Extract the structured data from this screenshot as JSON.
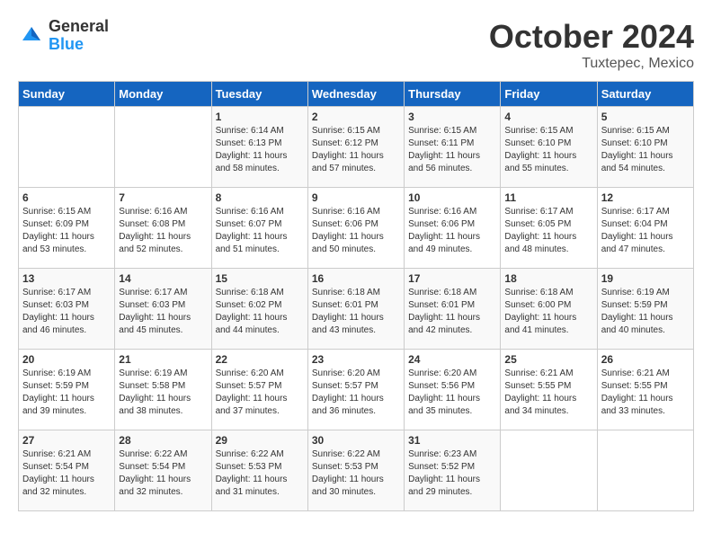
{
  "logo": {
    "general": "General",
    "blue": "Blue"
  },
  "title": "October 2024",
  "location": "Tuxtepec, Mexico",
  "days_header": [
    "Sunday",
    "Monday",
    "Tuesday",
    "Wednesday",
    "Thursday",
    "Friday",
    "Saturday"
  ],
  "weeks": [
    [
      {
        "num": "",
        "info": ""
      },
      {
        "num": "",
        "info": ""
      },
      {
        "num": "1",
        "info": "Sunrise: 6:14 AM\nSunset: 6:13 PM\nDaylight: 11 hours and 58 minutes."
      },
      {
        "num": "2",
        "info": "Sunrise: 6:15 AM\nSunset: 6:12 PM\nDaylight: 11 hours and 57 minutes."
      },
      {
        "num": "3",
        "info": "Sunrise: 6:15 AM\nSunset: 6:11 PM\nDaylight: 11 hours and 56 minutes."
      },
      {
        "num": "4",
        "info": "Sunrise: 6:15 AM\nSunset: 6:10 PM\nDaylight: 11 hours and 55 minutes."
      },
      {
        "num": "5",
        "info": "Sunrise: 6:15 AM\nSunset: 6:10 PM\nDaylight: 11 hours and 54 minutes."
      }
    ],
    [
      {
        "num": "6",
        "info": "Sunrise: 6:15 AM\nSunset: 6:09 PM\nDaylight: 11 hours and 53 minutes."
      },
      {
        "num": "7",
        "info": "Sunrise: 6:16 AM\nSunset: 6:08 PM\nDaylight: 11 hours and 52 minutes."
      },
      {
        "num": "8",
        "info": "Sunrise: 6:16 AM\nSunset: 6:07 PM\nDaylight: 11 hours and 51 minutes."
      },
      {
        "num": "9",
        "info": "Sunrise: 6:16 AM\nSunset: 6:06 PM\nDaylight: 11 hours and 50 minutes."
      },
      {
        "num": "10",
        "info": "Sunrise: 6:16 AM\nSunset: 6:06 PM\nDaylight: 11 hours and 49 minutes."
      },
      {
        "num": "11",
        "info": "Sunrise: 6:17 AM\nSunset: 6:05 PM\nDaylight: 11 hours and 48 minutes."
      },
      {
        "num": "12",
        "info": "Sunrise: 6:17 AM\nSunset: 6:04 PM\nDaylight: 11 hours and 47 minutes."
      }
    ],
    [
      {
        "num": "13",
        "info": "Sunrise: 6:17 AM\nSunset: 6:03 PM\nDaylight: 11 hours and 46 minutes."
      },
      {
        "num": "14",
        "info": "Sunrise: 6:17 AM\nSunset: 6:03 PM\nDaylight: 11 hours and 45 minutes."
      },
      {
        "num": "15",
        "info": "Sunrise: 6:18 AM\nSunset: 6:02 PM\nDaylight: 11 hours and 44 minutes."
      },
      {
        "num": "16",
        "info": "Sunrise: 6:18 AM\nSunset: 6:01 PM\nDaylight: 11 hours and 43 minutes."
      },
      {
        "num": "17",
        "info": "Sunrise: 6:18 AM\nSunset: 6:01 PM\nDaylight: 11 hours and 42 minutes."
      },
      {
        "num": "18",
        "info": "Sunrise: 6:18 AM\nSunset: 6:00 PM\nDaylight: 11 hours and 41 minutes."
      },
      {
        "num": "19",
        "info": "Sunrise: 6:19 AM\nSunset: 5:59 PM\nDaylight: 11 hours and 40 minutes."
      }
    ],
    [
      {
        "num": "20",
        "info": "Sunrise: 6:19 AM\nSunset: 5:59 PM\nDaylight: 11 hours and 39 minutes."
      },
      {
        "num": "21",
        "info": "Sunrise: 6:19 AM\nSunset: 5:58 PM\nDaylight: 11 hours and 38 minutes."
      },
      {
        "num": "22",
        "info": "Sunrise: 6:20 AM\nSunset: 5:57 PM\nDaylight: 11 hours and 37 minutes."
      },
      {
        "num": "23",
        "info": "Sunrise: 6:20 AM\nSunset: 5:57 PM\nDaylight: 11 hours and 36 minutes."
      },
      {
        "num": "24",
        "info": "Sunrise: 6:20 AM\nSunset: 5:56 PM\nDaylight: 11 hours and 35 minutes."
      },
      {
        "num": "25",
        "info": "Sunrise: 6:21 AM\nSunset: 5:55 PM\nDaylight: 11 hours and 34 minutes."
      },
      {
        "num": "26",
        "info": "Sunrise: 6:21 AM\nSunset: 5:55 PM\nDaylight: 11 hours and 33 minutes."
      }
    ],
    [
      {
        "num": "27",
        "info": "Sunrise: 6:21 AM\nSunset: 5:54 PM\nDaylight: 11 hours and 32 minutes."
      },
      {
        "num": "28",
        "info": "Sunrise: 6:22 AM\nSunset: 5:54 PM\nDaylight: 11 hours and 32 minutes."
      },
      {
        "num": "29",
        "info": "Sunrise: 6:22 AM\nSunset: 5:53 PM\nDaylight: 11 hours and 31 minutes."
      },
      {
        "num": "30",
        "info": "Sunrise: 6:22 AM\nSunset: 5:53 PM\nDaylight: 11 hours and 30 minutes."
      },
      {
        "num": "31",
        "info": "Sunrise: 6:23 AM\nSunset: 5:52 PM\nDaylight: 11 hours and 29 minutes."
      },
      {
        "num": "",
        "info": ""
      },
      {
        "num": "",
        "info": ""
      }
    ]
  ]
}
